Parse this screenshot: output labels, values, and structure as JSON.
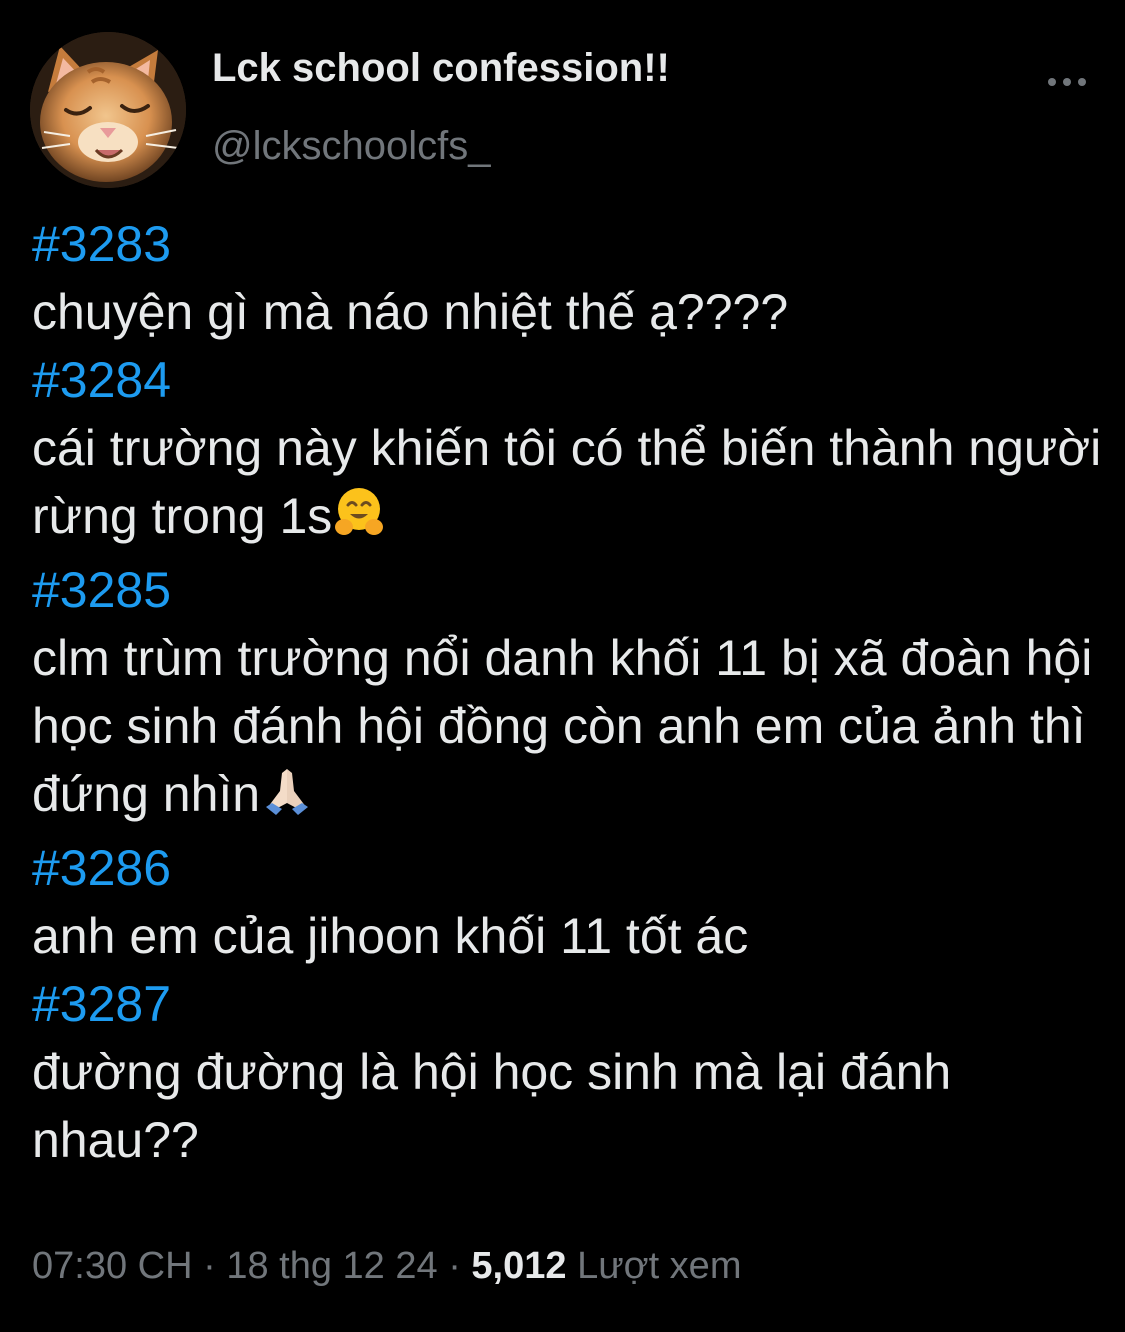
{
  "author": {
    "display_name": "Lck school confession!!",
    "handle": "@lckschoolcfs_"
  },
  "icons": {
    "avatar": "cat-avatar",
    "more": "more-horizontal-icon"
  },
  "colors": {
    "background": "#000000",
    "text": "#e7e9ea",
    "secondary": "#71767b",
    "link": "#1d9bf0"
  },
  "entries": [
    {
      "number": "#3283",
      "text": "chuyện gì mà náo nhiệt thế ạ????"
    },
    {
      "number": "#3284",
      "text": "cái trường này khiến tôi có thể biến thành người rừng trong 1s",
      "emoji": "hugging-face-emoji"
    },
    {
      "number": "#3285",
      "text": "clm trùm trường nổi danh khối 11 bị xã đoàn hội học sinh đánh hội đồng còn anh em của ảnh thì đứng nhìn",
      "emoji": "folded-hands-emoji"
    },
    {
      "number": "#3286",
      "text": "anh em của jihoon khối 11 tốt ác"
    },
    {
      "number": "#3287",
      "text": "đường đường là hội học sinh mà lại đánh nhau??"
    }
  ],
  "footer": {
    "time": "07:30 CH",
    "separator": " · ",
    "date": "18 thg 12 24",
    "views_count": "5,012",
    "views_label": "Lượt xem"
  }
}
